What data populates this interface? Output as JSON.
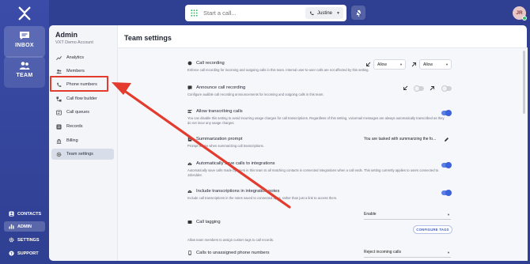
{
  "rail": {
    "inbox_label": "INBOX",
    "team_label": "TEAM",
    "contacts_label": "CONTACTS",
    "admin_label": "ADMIN",
    "settings_label": "SETTINGS",
    "support_label": "SUPPORT"
  },
  "topbar": {
    "call_placeholder": "Start a call...",
    "caller_name": "Justine",
    "avatar_initials": "JR"
  },
  "admin": {
    "title": "Admin",
    "subtitle": "VXT Demo Account",
    "items": [
      {
        "label": "Analytics",
        "icon": "analytics-icon"
      },
      {
        "label": "Members",
        "icon": "members-icon"
      },
      {
        "label": "Phone numbers",
        "icon": "phone-icon"
      },
      {
        "label": "Call flow builder",
        "icon": "flow-icon"
      },
      {
        "label": "Call queues",
        "icon": "queue-icon"
      },
      {
        "label": "Records",
        "icon": "records-icon"
      },
      {
        "label": "Billing",
        "icon": "billing-icon"
      },
      {
        "label": "Team settings",
        "icon": "gear-icon"
      }
    ]
  },
  "main": {
    "title": "Team settings",
    "settings": [
      {
        "name": "Call recording",
        "desc": "Enforce call recording for incoming and outgoing calls in this team. Internal user-to-user calls are not affected by this setting."
      },
      {
        "name": "Announce call recording",
        "desc": "Configure audible call recording announcements for incoming and outgoing calls in this team."
      },
      {
        "name": "Allow transcribing calls",
        "desc": "You can disable this setting to avoid incurring usage charges for call transcriptions. Regardless of this setting, voicemail messages are always automatically transcribed as they do not incur any usage charges."
      },
      {
        "name": "Summarization prompt",
        "desc": "Prompt to use when summarizing call transcriptions."
      },
      {
        "name": "Automatically save calls to integrations",
        "desc": "Automatically save calls made by users in this team to all matching contacts in connected integrations when a call ends. This setting currently applies to users connected to JobAdder."
      },
      {
        "name": "Include transcriptions in integration notes",
        "desc": "Include call transcriptions in the notes saved to connected apps, rather than just a link to access them."
      },
      {
        "name": "Call tagging",
        "desc": "Allow team members to assign custom tags to call records."
      },
      {
        "name": "Calls to unassigned phone numbers",
        "desc": ""
      }
    ],
    "recording_in": "Allow",
    "recording_out": "Allow",
    "summary_prompt": "You are tasked with summarizing the fo...",
    "tagging_value": "Enable",
    "configure_tags": "CONFIGURE TAGS",
    "unassigned_value": "Reject incoming calls"
  },
  "colors": {
    "brand": "#2f3f91",
    "toggle_on": "#3d63d9",
    "annotation": "#e33b2e"
  }
}
